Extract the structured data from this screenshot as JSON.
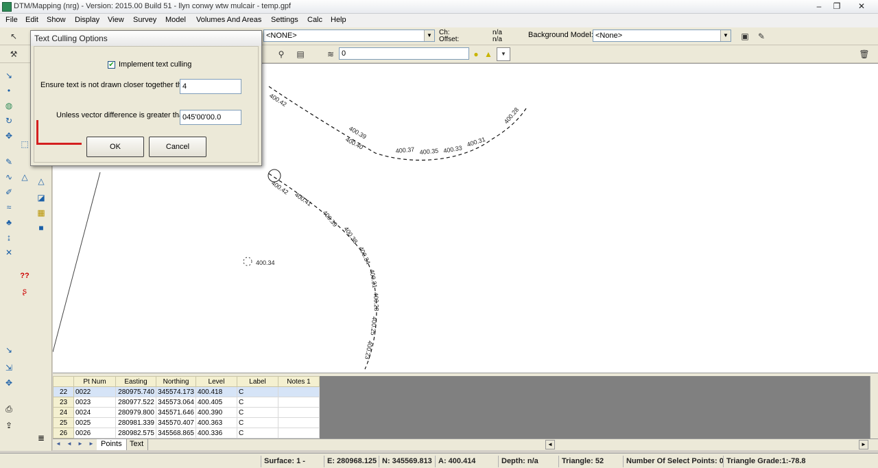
{
  "window": {
    "title": "DTM/Mapping (nrg) - Version: 2015.00 Build 51 - llyn conwy wtw mulcair - temp.gpf",
    "controls": [
      "–",
      "❐",
      "✕"
    ]
  },
  "menu": [
    "File",
    "Edit",
    "Show",
    "Display",
    "View",
    "Survey",
    "Model",
    "Volumes And Areas",
    "Settings",
    "Calc",
    "Help"
  ],
  "toolbar1": {
    "feature_combo": "<NONE>",
    "chy_label": "Ch:",
    "offset_label": "Offset:",
    "chy_value": "n/a",
    "offset_value": "n/a",
    "background_model_label": "Background Model:",
    "background_model_value": "<None>"
  },
  "toolbar2": {
    "layer_combo": "0"
  },
  "drawing": {
    "labels_top": [
      "400.42",
      "400.39",
      "400.40",
      "400.37",
      "400.35",
      "400.33",
      "400.31",
      "400.28"
    ],
    "labels_bottom": [
      "400.42",
      "400.41",
      "400.39",
      "400.38",
      "400.34",
      "400.31",
      "400.28",
      "400.25",
      "400.23"
    ],
    "isolated_label": "400.34"
  },
  "dialog": {
    "title": "Text Culling Options",
    "checkbox_label": "Implement text culling",
    "checkbox_checked": true,
    "min_distance_label": "Ensure text is not drawn closer together than:",
    "min_distance_value": "4",
    "vector_label": "Unless vector difference is greater than:",
    "vector_value": "045'00'00.0",
    "ok_label": "OK",
    "cancel_label": "Cancel"
  },
  "table": {
    "columns": [
      "Pt Num",
      "Easting",
      "Northing",
      "Level",
      "Label",
      "Notes 1"
    ],
    "rows": [
      {
        "row": "22",
        "pt": "0022",
        "easting": "280975.740",
        "northing": "345574.173",
        "level": "400.418",
        "label": "C",
        "notes": ""
      },
      {
        "row": "23",
        "pt": "0023",
        "easting": "280977.522",
        "northing": "345573.064",
        "level": "400.405",
        "label": "C",
        "notes": ""
      },
      {
        "row": "24",
        "pt": "0024",
        "easting": "280979.800",
        "northing": "345571.646",
        "level": "400.390",
        "label": "C",
        "notes": ""
      },
      {
        "row": "25",
        "pt": "0025",
        "easting": "280981.339",
        "northing": "345570.407",
        "level": "400.363",
        "label": "C",
        "notes": ""
      },
      {
        "row": "26",
        "pt": "0026",
        "easting": "280982.575",
        "northing": "345568.865",
        "level": "400.336",
        "label": "C",
        "notes": ""
      }
    ],
    "sheet_tabs": [
      "Points",
      "Text"
    ]
  },
  "status": {
    "surface": "Surface: 1 -",
    "east": "E: 280968.125",
    "north": "N: 345569.813",
    "level": "A: 400.414",
    "depth": "Depth: n/a",
    "triangle": "Triangle: 52",
    "select_points": "Number Of Select Points: 0",
    "grade": "Triangle Grade:1:-78.8"
  },
  "colors": {
    "accent_red": "#d41f1f",
    "selected_row": "#d6e4f7",
    "header_bg": "#f4f0d0"
  }
}
